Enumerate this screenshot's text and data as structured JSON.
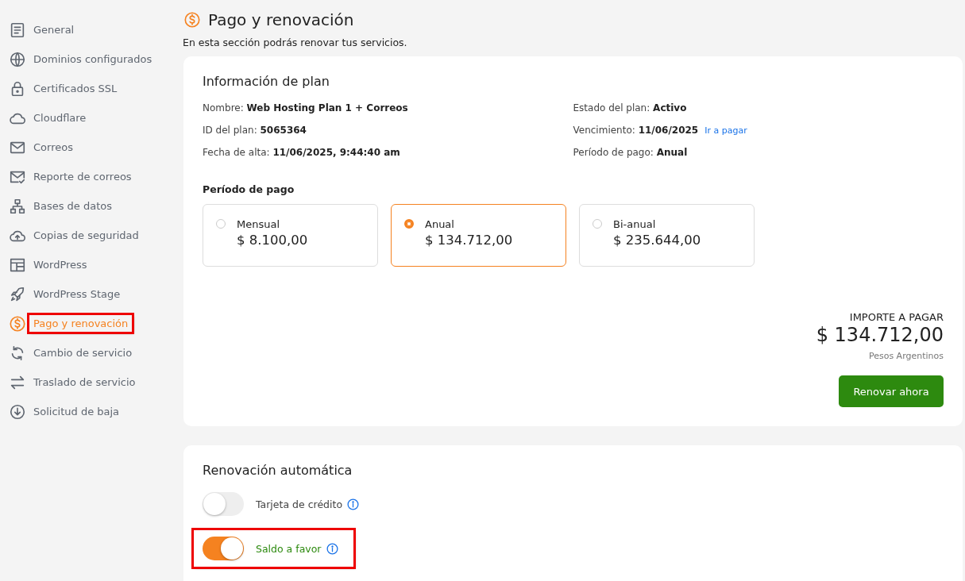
{
  "sidebar": {
    "items": [
      {
        "label": "General",
        "kind": "doc",
        "selected": false,
        "highlighted": false
      },
      {
        "label": "Dominios configurados",
        "kind": "globe",
        "selected": false,
        "highlighted": false
      },
      {
        "label": "Certificados SSL",
        "kind": "lock",
        "selected": false,
        "highlighted": false
      },
      {
        "label": "Cloudflare",
        "kind": "cloud",
        "selected": false,
        "highlighted": false
      },
      {
        "label": "Correos",
        "kind": "mail",
        "selected": false,
        "highlighted": false
      },
      {
        "label": "Reporte de correos",
        "kind": "mailcheck",
        "selected": false,
        "highlighted": false
      },
      {
        "label": "Bases de datos",
        "kind": "db",
        "selected": false,
        "highlighted": false
      },
      {
        "label": "Copias de seguridad",
        "kind": "upload",
        "selected": false,
        "highlighted": false
      },
      {
        "label": "WordPress",
        "kind": "layout",
        "selected": false,
        "highlighted": false
      },
      {
        "label": "WordPress Stage",
        "kind": "rocket",
        "selected": false,
        "highlighted": false
      },
      {
        "label": "Pago y renovación",
        "kind": "dollar",
        "selected": true,
        "highlighted": true
      },
      {
        "label": "Cambio de servicio",
        "kind": "refresh",
        "selected": false,
        "highlighted": false
      },
      {
        "label": "Traslado de servicio",
        "kind": "swap",
        "selected": false,
        "highlighted": false
      },
      {
        "label": "Solicitud de baja",
        "kind": "down",
        "selected": false,
        "highlighted": false
      }
    ]
  },
  "page": {
    "title": "Pago y renovación",
    "subtitle": "En esta sección podrás renovar tus servicios."
  },
  "plan_info": {
    "title": "Información de plan",
    "left": [
      "Nombre: **Web Hosting Plan 1 + Correos**",
      "ID del plan: **5065364**",
      "Fecha de alta: **11/06/2025, 9:44:40 am**"
    ],
    "right": [
      "Estado del plan: **Activo**",
      "Vencimiento: **11/06/2025**",
      "Período de pago: **Anual**"
    ],
    "pay_link": "Ir a pagar",
    "period_title": "Período de pago",
    "periods": [
      {
        "name": "Mensual",
        "price": "$ 8.100,00",
        "selected": false
      },
      {
        "name": "Anual",
        "price": "$ 134.712,00",
        "selected": true
      },
      {
        "name": "Bi-anual",
        "price": "$ 235.644,00",
        "selected": false
      }
    ],
    "amount_label": "IMPORTE A PAGAR",
    "amount": "$ 134.712,00",
    "currency": "Pesos Argentinos",
    "button": "Renovar ahora"
  },
  "auto_renewal": {
    "title": "Renovación automática",
    "options": [
      {
        "label": "Tarjeta de crédito",
        "on": false,
        "highlighted": false
      },
      {
        "label": "Saldo a favor",
        "on": true,
        "highlighted": true
      }
    ]
  }
}
